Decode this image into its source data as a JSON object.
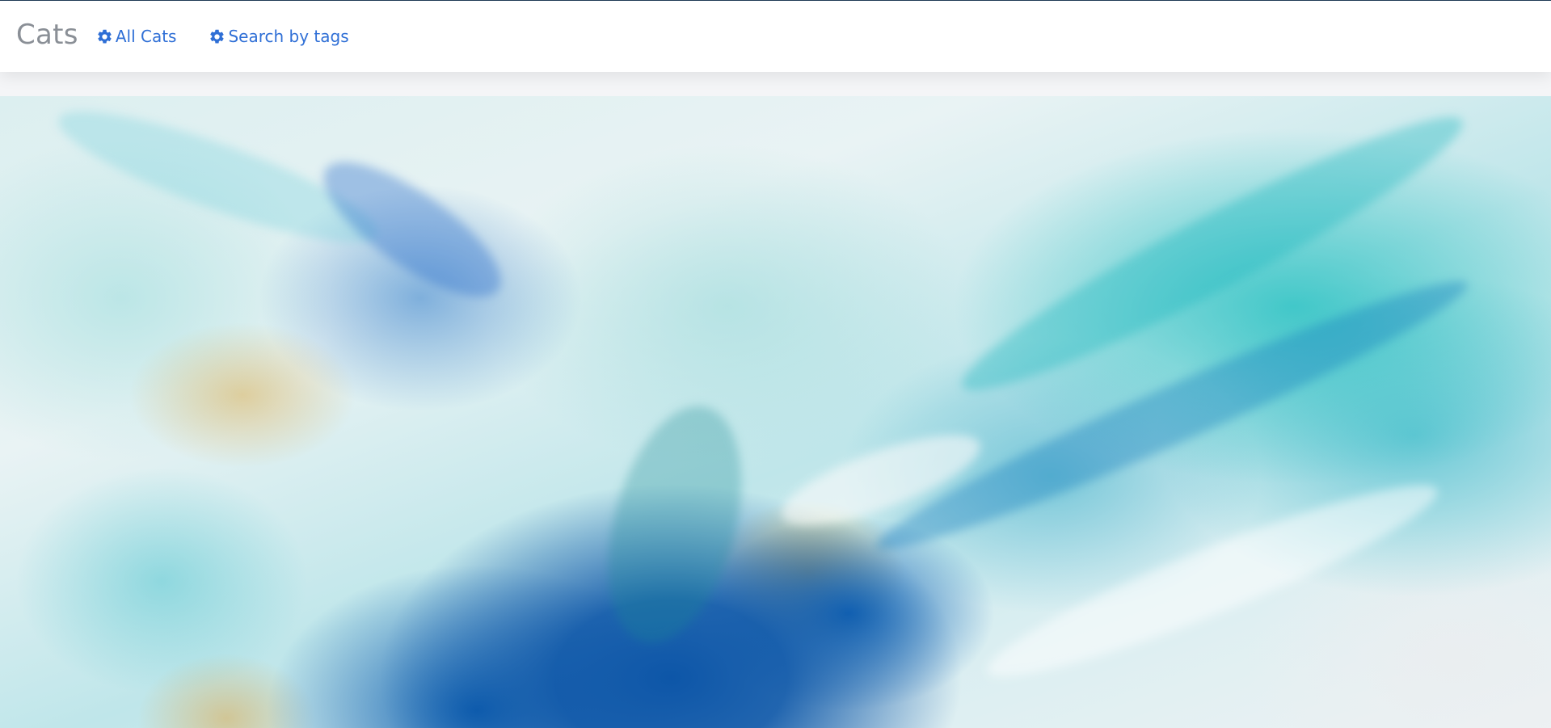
{
  "navbar": {
    "brand": "Cats",
    "links": [
      {
        "label": "All Cats",
        "icon": "gear-icon"
      },
      {
        "label": "Search by tags",
        "icon": "gear-icon"
      }
    ]
  },
  "colors": {
    "brand_text": "#8a8f96",
    "link": "#2f6fd6",
    "top_border": "#1f3b57",
    "page_background": "#f4f5f7"
  },
  "hero": {
    "image": "abstract-fluid-art-background"
  }
}
